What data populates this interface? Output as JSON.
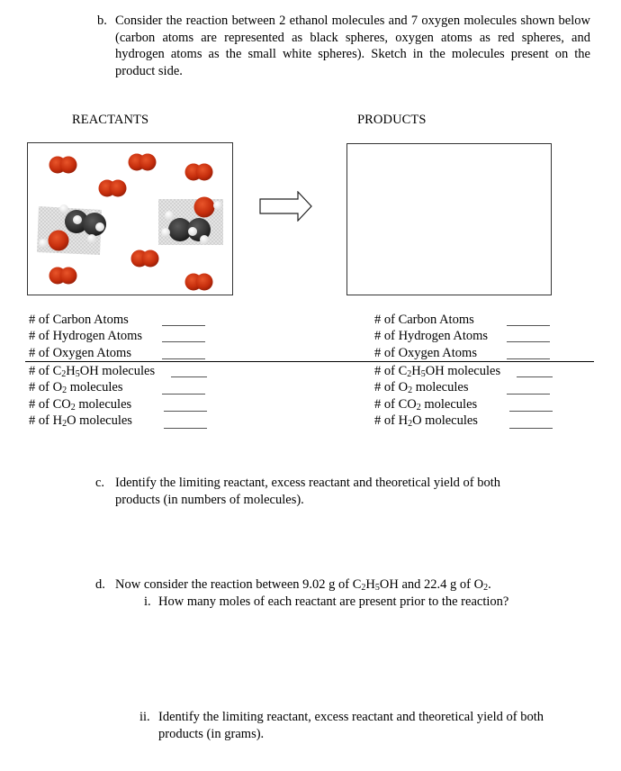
{
  "part_b": {
    "marker": "b.",
    "text": "Consider the reaction between 2 ethanol molecules and 7 oxygen molecules shown below (carbon atoms are represented as black spheres, oxygen atoms as red spheres, and hydrogen atoms as the small white spheres).  Sketch in the molecules present on the product side."
  },
  "reactants_label": "REACTANTS",
  "products_label": "PRODUCTS",
  "reactants_box": {
    "o2_molecule_count": 7,
    "ethanol_molecule_count": 2,
    "colors": {
      "oxygen": "#c9300f",
      "carbon": "#3a3a3a",
      "hydrogen": "#ffffff"
    }
  },
  "arrow_icon": "right-arrow",
  "products_box": {
    "content": ""
  },
  "reactant_counts": {
    "atoms": [
      {
        "label": "# of Carbon Atoms",
        "value": ""
      },
      {
        "label": "# of Hydrogen Atoms",
        "value": ""
      },
      {
        "label": "# of Oxygen Atoms",
        "value": ""
      }
    ],
    "molecules": [
      {
        "prefix": "# of C",
        "s1": "2",
        "m1": "H",
        "s2": "5",
        "suffix": "OH molecules",
        "value": ""
      },
      {
        "prefix": "# of O",
        "s1": "2",
        "suffix": " molecules",
        "value": ""
      },
      {
        "prefix": "# of CO",
        "s1": "2",
        "suffix": " molecules",
        "value": ""
      },
      {
        "prefix": "# of H",
        "s1": "2",
        "suffix": "O molecules",
        "value": ""
      }
    ]
  },
  "product_counts": {
    "atoms": [
      {
        "label": "# of Carbon Atoms",
        "value": ""
      },
      {
        "label": "# of Hydrogen Atoms",
        "value": ""
      },
      {
        "label": "# of Oxygen Atoms",
        "value": ""
      }
    ],
    "molecules": [
      {
        "prefix": "# of C",
        "s1": "2",
        "m1": "H",
        "s2": "5",
        "suffix": "OH molecules",
        "value": ""
      },
      {
        "prefix": "# of O",
        "s1": "2",
        "suffix": " molecules",
        "value": ""
      },
      {
        "prefix": "# of CO",
        "s1": "2",
        "suffix": " molecules",
        "value": ""
      },
      {
        "prefix": "# of H",
        "s1": "2",
        "suffix": "O molecules",
        "value": ""
      }
    ]
  },
  "part_c": {
    "marker": "c.",
    "text": "Identify the limiting reactant, excess reactant and theoretical yield of both products (in numbers of molecules)."
  },
  "part_d": {
    "marker": "d.",
    "text_pre": "Now consider the reaction between 9.02 g of C",
    "sub1": "2",
    "mid1": "H",
    "sub2": "5",
    "mid2": "OH and 22.4 g of O",
    "sub3": "2",
    "text_post": ".",
    "sub_i": {
      "marker": "i.",
      "text": "How many moles of each reactant are present prior to the reaction?"
    },
    "sub_ii": {
      "marker": "ii.",
      "text": "Identify the limiting reactant, excess reactant and theoretical yield of both products (in grams)."
    }
  }
}
